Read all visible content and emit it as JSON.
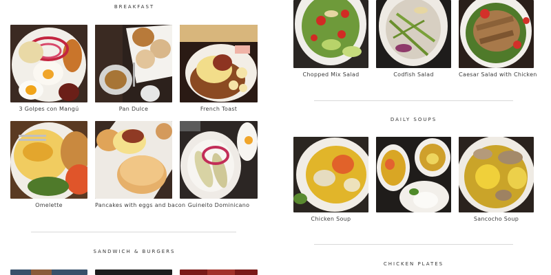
{
  "left": {
    "breakfast": {
      "title": "BREAKFAST",
      "items": [
        {
          "label": "3 Golpes con Mangú",
          "icon": "mangu-plate-photo"
        },
        {
          "label": "Pan Dulce",
          "icon": "pan-dulce-photo"
        },
        {
          "label": "French Toast",
          "icon": "french-toast-photo"
        },
        {
          "label": "Omelette",
          "icon": "omelette-photo"
        },
        {
          "label": "Pancakes with eggs and bacon",
          "icon": "pancakes-photo"
        },
        {
          "label": "Guineito Dominicano",
          "icon": "guineito-photo"
        }
      ]
    },
    "sandwich": {
      "title": "SANDWICH & BURGERS"
    }
  },
  "right": {
    "salads": {
      "items": [
        {
          "label": "Chopped Mix Salad",
          "icon": "chopped-salad-photo"
        },
        {
          "label": "Codfish Salad",
          "icon": "codfish-salad-photo"
        },
        {
          "label": "Caesar Salad with Chicken",
          "icon": "caesar-salad-photo"
        }
      ]
    },
    "soups": {
      "title": "DAILY SOUPS",
      "items": [
        {
          "label": "Chicken Soup",
          "icon": "chicken-soup-photo"
        },
        {
          "label": "Sancocho Soup",
          "icon": "sancocho-soup-photo"
        }
      ]
    },
    "chicken": {
      "title": "CHICKEN PLATES"
    }
  }
}
